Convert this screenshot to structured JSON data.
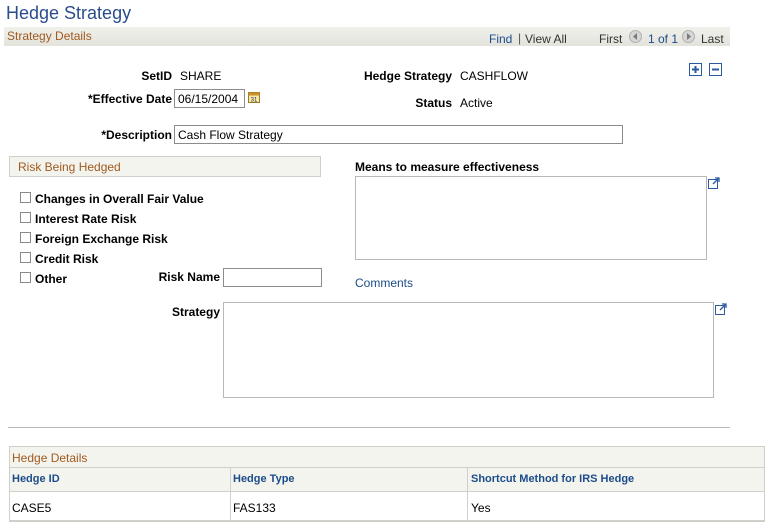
{
  "page": {
    "title": "Hedge Strategy"
  },
  "strategy_details": {
    "section_title": "Strategy Details",
    "find": "Find",
    "separator": "|",
    "view_all": "View All",
    "first": "First",
    "pager": "1 of 1",
    "last": "Last"
  },
  "form": {
    "setid_label": "SetID",
    "setid_value": "SHARE",
    "hedge_strategy_label": "Hedge Strategy",
    "hedge_strategy_value": "CASHFLOW",
    "effective_date_label": "*Effective Date",
    "effective_date_value": "06/15/2004",
    "status_label": "Status",
    "status_value": "Active",
    "description_label": "*Description",
    "description_value": "Cash Flow Strategy"
  },
  "risk": {
    "section_title": "Risk Being Hedged",
    "items": [
      {
        "label": "Changes in Overall Fair Value",
        "checked": false
      },
      {
        "label": "Interest Rate Risk",
        "checked": false
      },
      {
        "label": "Foreign Exchange Risk",
        "checked": false
      },
      {
        "label": "Credit Risk",
        "checked": false
      },
      {
        "label": "Other",
        "checked": false
      }
    ],
    "risk_name_label": "Risk Name",
    "risk_name_value": ""
  },
  "effectiveness": {
    "label": "Means to measure effectiveness",
    "comments_link": "Comments"
  },
  "strategy": {
    "label": "Strategy"
  },
  "hedge_details": {
    "section_title": "Hedge Details",
    "columns": [
      "Hedge ID",
      "Hedge Type",
      "Shortcut Method for IRS Hedge"
    ],
    "rows": [
      [
        "CASE5",
        "FAS133",
        "Yes"
      ]
    ]
  },
  "icons": {
    "calendar": "calendar-icon",
    "expand": "expand-icon",
    "add_row": "plus-icon",
    "delete_row": "minus-icon"
  },
  "colors": {
    "title_blue": "#2b4d8c",
    "section_orange": "#a05a1e",
    "link_blue": "#1c4c8a"
  }
}
